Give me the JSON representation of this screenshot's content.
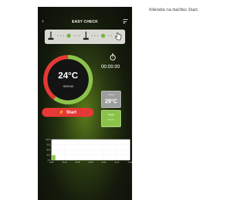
{
  "instruction": "Klikněte na tlačítko Start.",
  "header": {
    "title": "EASY CHECK"
  },
  "timer": {
    "value": "00:00:00"
  },
  "gauge": {
    "temperature": "24°C",
    "label": "Internal",
    "fill_fraction": 0.6
  },
  "oven": {
    "label": "Oven",
    "value": "29°C"
  },
  "target": {
    "label": "Target",
    "value": "----"
  },
  "start_button": {
    "label": "Start"
  },
  "colors": {
    "accent_green": "#8bc34a",
    "start_red": "#e53935",
    "gauge_red": "#e53935",
    "oven_gray": "#9e9e9e"
  },
  "icons": [
    "back-icon",
    "menu-icon",
    "stopwatch-icon",
    "bolt-icon",
    "probe-icon",
    "check-icon",
    "hand-icon"
  ],
  "chart_data": {
    "type": "bar",
    "y_ticks": [
      "100°C",
      "75°C",
      "50°C",
      "25°C",
      "0°C"
    ],
    "x_ticks": [
      "00:00",
      "00:15",
      "00:30",
      "00:45",
      "01:00",
      "01:15",
      "01:30"
    ],
    "values": [
      24
    ],
    "ylim": [
      0,
      100
    ]
  }
}
